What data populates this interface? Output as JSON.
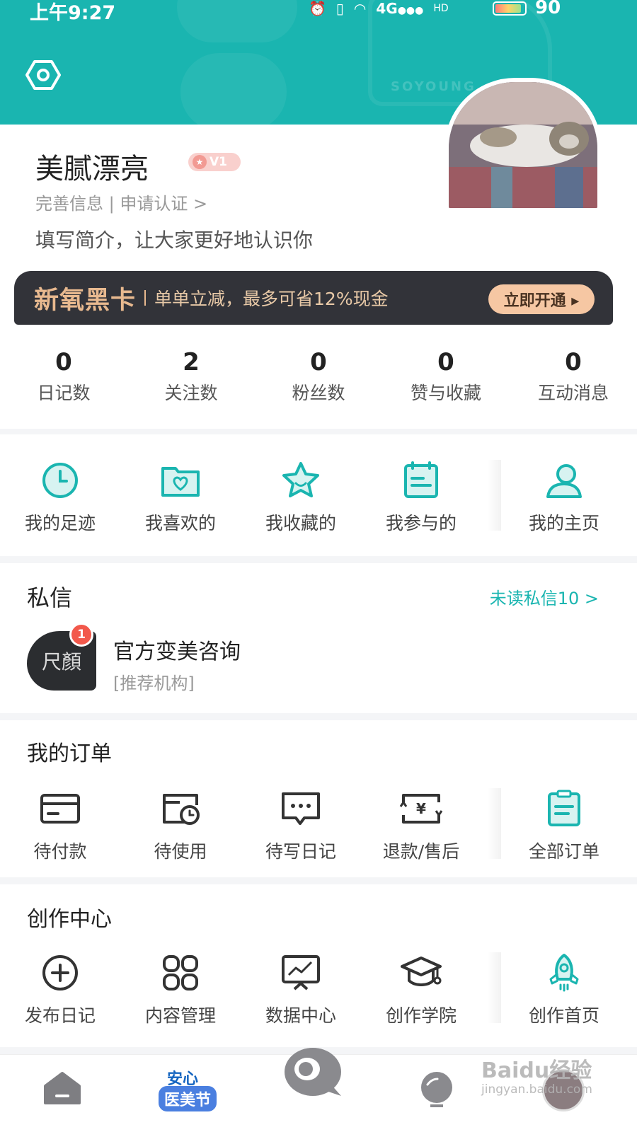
{
  "status_bar": {
    "time": "上午9:27",
    "battery": "90",
    "signal": "4G",
    "hd": "HD",
    "battery_level": 0.9
  },
  "header": {
    "watermark_text": "SOYOUNG",
    "settings_icon": "settings-icon"
  },
  "profile": {
    "username": "美腻漂亮",
    "level": "V1",
    "complete_info": "完善信息 | 申请认证 >",
    "bio_placeholder": "填写简介，让大家更好地认识你"
  },
  "black_card": {
    "title": "新氧黑卡",
    "description": "单单立减，最多可省12%现金",
    "button": "立即开通 ▸"
  },
  "stats": [
    {
      "value": "0",
      "label": "日记数"
    },
    {
      "value": "2",
      "label": "关注数"
    },
    {
      "value": "0",
      "label": "粉丝数"
    },
    {
      "value": "0",
      "label": "赞与收藏"
    },
    {
      "value": "0",
      "label": "互动消息"
    }
  ],
  "quick_links": [
    {
      "label": "我的足迹",
      "icon": "clock-icon"
    },
    {
      "label": "我喜欢的",
      "icon": "heart-folder-icon"
    },
    {
      "label": "我收藏的",
      "icon": "star-icon"
    },
    {
      "label": "我参与的",
      "icon": "calendar-icon"
    },
    {
      "label": "我的主页",
      "icon": "user-icon"
    }
  ],
  "messages": {
    "title": "私信",
    "unread_link": "未读私信10 >",
    "item": {
      "name": "官方变美咨询",
      "tag": "[推荐机构]",
      "avatar_text": "尺顏",
      "badge": "1"
    }
  },
  "orders": {
    "title": "我的订单",
    "items": [
      {
        "label": "待付款",
        "icon": "card-icon"
      },
      {
        "label": "待使用",
        "icon": "clock-card-icon"
      },
      {
        "label": "待写日记",
        "icon": "comment-icon"
      },
      {
        "label": "退款/售后",
        "icon": "refund-icon"
      },
      {
        "label": "全部订单",
        "icon": "clipboard-icon"
      }
    ]
  },
  "creation": {
    "title": "创作中心",
    "items": [
      {
        "label": "发布日记",
        "icon": "plus-circle-icon"
      },
      {
        "label": "内容管理",
        "icon": "grid-icon"
      },
      {
        "label": "数据中心",
        "icon": "monitor-chart-icon"
      },
      {
        "label": "创作学院",
        "icon": "graduation-cap-icon"
      },
      {
        "label": "创作首页",
        "icon": "rocket-icon"
      }
    ]
  },
  "bottom_nav": {
    "festival_text_1": "安心",
    "festival_text_2": "医美节"
  },
  "watermark": {
    "line1": "Baidu经验",
    "line2": "jingyan.baidu.com"
  },
  "colors": {
    "brand": "#1ab5b0",
    "black_card_bg": "#323339",
    "gold": "#e8b98f",
    "badge_red": "#f2584b"
  }
}
